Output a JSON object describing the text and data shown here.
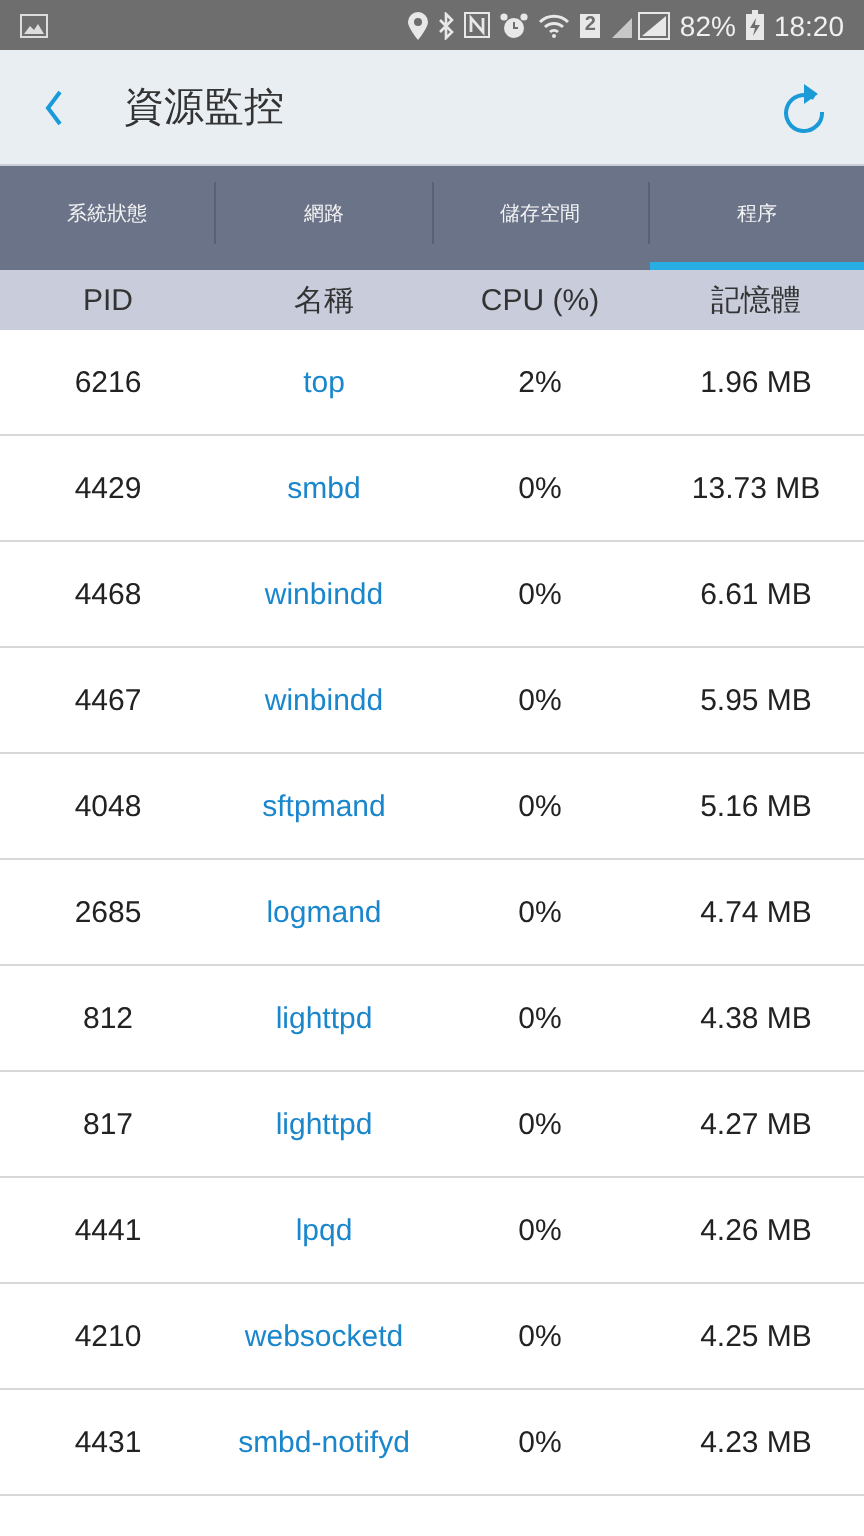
{
  "status_bar": {
    "sim_badge": "2",
    "battery": "82%",
    "time": "18:20"
  },
  "header": {
    "title": "資源監控"
  },
  "tabs": [
    {
      "label": "系統狀態",
      "selected": false
    },
    {
      "label": "網路",
      "selected": false
    },
    {
      "label": "儲存空間",
      "selected": false
    },
    {
      "label": "程序",
      "selected": true
    }
  ],
  "table": {
    "columns": [
      "PID",
      "名稱",
      "CPU (%)",
      "記憶體"
    ],
    "rows": [
      [
        "6216",
        "top",
        "2%",
        "1.96 MB"
      ],
      [
        "4429",
        "smbd",
        "0%",
        "13.73 MB"
      ],
      [
        "4468",
        "winbindd",
        "0%",
        "6.61 MB"
      ],
      [
        "4467",
        "winbindd",
        "0%",
        "5.95 MB"
      ],
      [
        "4048",
        "sftpmand",
        "0%",
        "5.16 MB"
      ],
      [
        "2685",
        "logmand",
        "0%",
        "4.74 MB"
      ],
      [
        "812",
        "lighttpd",
        "0%",
        "4.38 MB"
      ],
      [
        "817",
        "lighttpd",
        "0%",
        "4.27 MB"
      ],
      [
        "4441",
        "lpqd",
        "0%",
        "4.26 MB"
      ],
      [
        "4210",
        "websocketd",
        "0%",
        "4.25 MB"
      ],
      [
        "4431",
        "smbd-notifyd",
        "0%",
        "4.23 MB"
      ]
    ]
  }
}
